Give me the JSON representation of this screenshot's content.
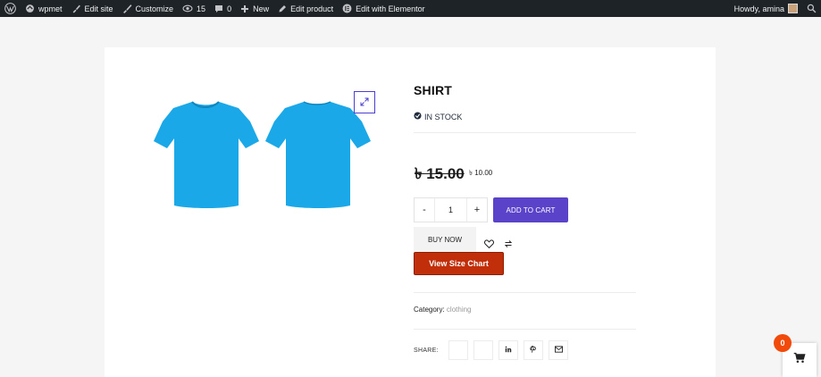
{
  "admin_bar": {
    "site_name": "wpmet",
    "edit_site": "Edit site",
    "customize": "Customize",
    "updates_count": "15",
    "comments_count": "0",
    "new": "New",
    "edit_product": "Edit product",
    "edit_elementor": "Edit with Elementor",
    "greeting": "Howdy, amina"
  },
  "product": {
    "title": "SHIRT",
    "stock": "IN STOCK",
    "regular_price": "৳ 15.00",
    "sale_price": "৳ 10.00",
    "quantity": "1",
    "qty_minus": "-",
    "qty_plus": "+",
    "add_to_cart": "ADD TO CART",
    "buy_now": "BUY NOW",
    "size_chart": "View Size Chart",
    "category_label": "Category:",
    "category_value": "clothing",
    "share_label": "SHARE:"
  },
  "cart": {
    "count": "0"
  },
  "colors": {
    "accent": "#5b43c9",
    "size_chart": "#c02f0a",
    "badge": "#f24a0b",
    "shirt": "#1aa8e8",
    "adminbar": "#1d2327"
  },
  "icons": [
    "wordpress-icon",
    "paintbrush-icon",
    "updates-icon",
    "comment-icon",
    "plus-icon",
    "pencil-icon",
    "elementor-icon",
    "search-icon",
    "expand-icon",
    "check-circle-icon",
    "heart-icon",
    "compare-icon",
    "linkedin-icon",
    "pinterest-icon",
    "email-icon",
    "cart-icon"
  ]
}
